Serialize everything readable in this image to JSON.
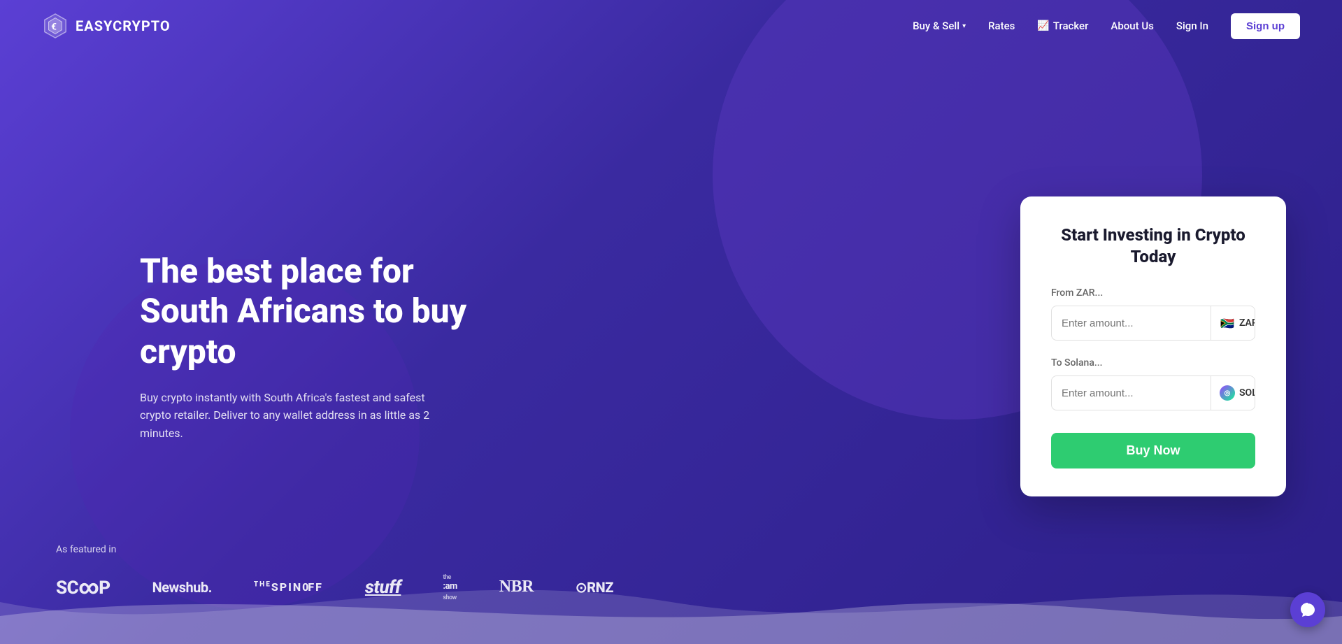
{
  "brand": {
    "name": "EASYCRYPTO",
    "logo_alt": "EasyCrypto logo"
  },
  "nav": {
    "buy_sell_label": "Buy & Sell",
    "rates_label": "Rates",
    "tracker_label": "Tracker",
    "about_label": "About Us",
    "signin_label": "Sign In",
    "signup_label": "Sign up"
  },
  "hero": {
    "title": "The best place for South Africans to buy crypto",
    "subtitle": "Buy crypto instantly with South Africa's fastest and safest crypto retailer. Deliver to any wallet address in as little as 2 minutes."
  },
  "card": {
    "title": "Start Investing in Crypto Today",
    "from_label": "From ZAR...",
    "from_placeholder": "Enter amount...",
    "from_currency": "ZAR",
    "to_label": "To Solana...",
    "to_placeholder": "Enter amount...",
    "to_currency": "SOL",
    "buy_label": "Buy Now"
  },
  "featured": {
    "label": "As featured in",
    "logos": [
      {
        "name": "Scoop",
        "display": "SC∞P"
      },
      {
        "name": "Newshub",
        "display": "Newshub."
      },
      {
        "name": "The Spinoff",
        "display": "ᵀᴴᴱSPINOFF"
      },
      {
        "name": "Stuff",
        "display": "stuff"
      },
      {
        "name": "The AM Show",
        "display": "the am show"
      },
      {
        "name": "NBR",
        "display": "NBR"
      },
      {
        "name": "RNZ",
        "display": "⊙RNZ"
      }
    ]
  },
  "colors": {
    "bg_start": "#5b3fd4",
    "bg_end": "#2d1f8a",
    "accent_green": "#2ecc71",
    "card_bg": "#ffffff",
    "text_dark": "#1a1a2e"
  }
}
